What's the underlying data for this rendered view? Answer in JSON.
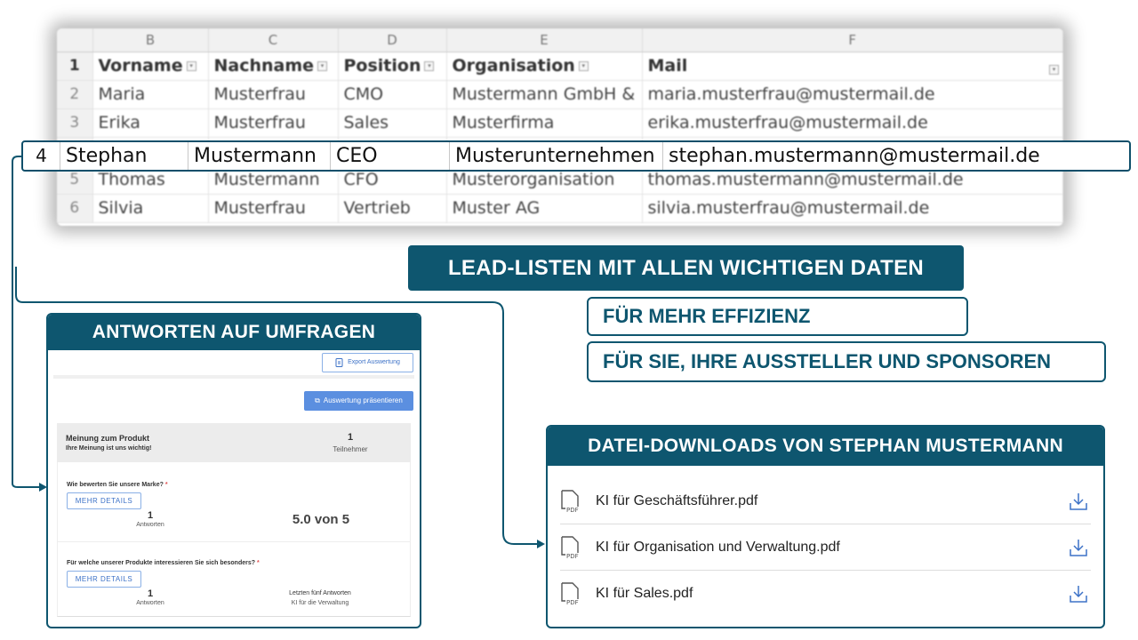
{
  "sheet": {
    "col_letters": [
      "B",
      "C",
      "D",
      "E",
      "F"
    ],
    "headers": [
      "Vorname",
      "Nachname",
      "Position",
      "Organisation",
      "Mail"
    ],
    "rows": [
      {
        "n": "1",
        "cells": [
          "Vorname",
          "Nachname",
          "Position",
          "Organisation",
          "Mail"
        ]
      },
      {
        "n": "2",
        "cells": [
          "Maria",
          "Musterfrau",
          "CMO",
          "Mustermann GmbH &",
          "maria.musterfrau@mustermail.de"
        ]
      },
      {
        "n": "3",
        "cells": [
          "Erika",
          "Musterfrau",
          "Sales",
          "Musterfirma",
          "erika.musterfrau@mustermail.de"
        ]
      },
      {
        "n": "5",
        "cells": [
          "Thomas",
          "Mustermann",
          "CFO",
          "Musterorganisation",
          "thomas.mustermann@mustermail.de"
        ]
      },
      {
        "n": "6",
        "cells": [
          "Silvia",
          "Musterfrau",
          "Vertrieb",
          "Muster AG",
          "silvia.musterfrau@mustermail.de"
        ]
      }
    ],
    "highlight": {
      "n": "4",
      "cells": [
        "Stephan",
        "Mustermann",
        "CEO",
        "Musterunternehmen",
        "stephan.mustermann@mustermail.de"
      ]
    }
  },
  "banners": {
    "lead": "LEAD-LISTEN MIT ALLEN WICHTIGEN DATEN",
    "effizienz": "FÜR MEHR EFFIZIENZ",
    "aussteller": "FÜR SIE, IHRE AUSSTELLER UND SPONSOREN"
  },
  "survey": {
    "title": "ANTWORTEN AUF UMFRAGEN",
    "export_label": "Export Auswertung",
    "present_label": "Auswertung präsentieren",
    "survey_name": "Meinung zum Produkt",
    "survey_sub": "Ihre Meinung ist uns wichtig!",
    "participants_count": "1",
    "participants_label": "Teilnehmer",
    "q1": {
      "text": "Wie bewerten Sie unsere Marke?",
      "required": "*",
      "details_label": "MEHR DETAILS",
      "count": "1",
      "count_label": "Antworten",
      "score": "5.0 von 5"
    },
    "q2": {
      "text": "Für welche unserer Produkte interessieren Sie sich besonders?",
      "required": "*",
      "details_label": "MEHR DETAILS",
      "count": "1",
      "count_label": "Antworten",
      "last_label": "Letzten fünf Antworten",
      "last_value": "KI für die Verwaltung"
    }
  },
  "downloads": {
    "title": "DATEI-DOWNLOADS VON STEPHAN MUSTERMANN",
    "pdf_tag": "PDF",
    "files": [
      {
        "name": "KI für Geschäftsführer.pdf"
      },
      {
        "name": "KI für Organisation und Verwaltung.pdf"
      },
      {
        "name": "KI für Sales.pdf"
      }
    ]
  },
  "colors": {
    "brand": "#0e566f",
    "button_blue": "#5b8fe0"
  }
}
